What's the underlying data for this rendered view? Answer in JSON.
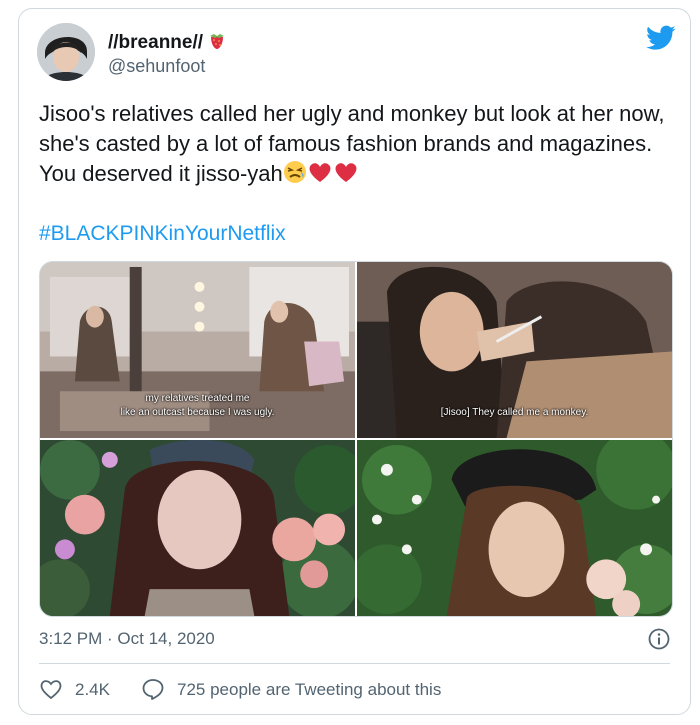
{
  "author": {
    "display_name": "//breanne//",
    "handle": "@sehunfoot"
  },
  "tweet": {
    "text": "Jisoo's relatives called her ugly and monkey but look at her now, she's casted by a lot of famous fashion brands and magazines. You deserved it jisso-yah",
    "hashtag": "#BLACKPINKinYourNetflix"
  },
  "media": {
    "photo1_caption_line1": "my relatives treated me",
    "photo1_caption_line2": "like an outcast because I was ugly.",
    "photo2_caption": "[Jisoo] They called me a monkey."
  },
  "meta": {
    "timestamp": "3:12 PM · Oct 14, 2020",
    "likes": "2.4K",
    "replies_text": "725 people are Tweeting about this"
  },
  "icons": [
    "strawberry-icon",
    "twitter-logo-icon",
    "tired-face-icon",
    "heart-emoji-icon",
    "info-icon",
    "like-icon",
    "reply-icon"
  ],
  "colors": {
    "link": "#1d9bf0",
    "secondary_text": "#536471",
    "heart": "#e0245e",
    "border": "#cfd9de"
  }
}
